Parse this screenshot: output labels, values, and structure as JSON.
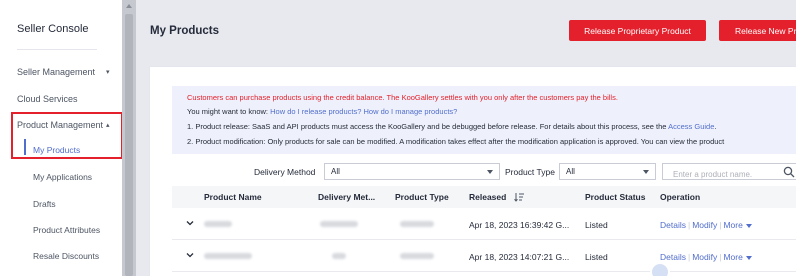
{
  "sidebar": {
    "title": "Seller Console",
    "items": [
      {
        "label": "Seller Management",
        "caret": "▾"
      },
      {
        "label": "Cloud Services"
      },
      {
        "label": "Product Management",
        "caret": "▴"
      }
    ],
    "sub_items": [
      {
        "label": "My Products",
        "active": true
      },
      {
        "label": "My Applications"
      },
      {
        "label": "Drafts"
      },
      {
        "label": "Product Attributes"
      },
      {
        "label": "Resale Discounts"
      }
    ]
  },
  "header": {
    "title": "My Products",
    "btn_proprietary": "Release Proprietary Product",
    "btn_new": "Release New Pr"
  },
  "notice": {
    "line1": "Customers can purchase products using the credit balance. The KooGallery settles with you only after the customers pay the bills.",
    "line2_prefix": "You might want to know: ",
    "line2_link1": "How do I release products?",
    "line2_link2": "How do I manage products?",
    "line3_text": "1. Product release: SaaS and API products must access the KooGallery and be debugged before release. For details about this process, see the ",
    "line3_link": "Access Guide",
    "line3_suffix": ".",
    "line4": "2. Product modification: Only products for sale can be modified. A modification takes effect after the modification application is approved. You can view the product"
  },
  "filters": {
    "delivery_label": "Delivery Method",
    "delivery_value": "All",
    "type_label": "Product Type",
    "type_value": "All",
    "search_placeholder": "Enter a product name."
  },
  "table": {
    "columns": [
      "Product Name",
      "Delivery Met...",
      "Product Type",
      "Released",
      "Product Status",
      "Operation"
    ],
    "rows": [
      {
        "released": "Apr 18, 2023 16:39:42 G...",
        "status": "Listed",
        "op_details": "Details",
        "op_modify": "Modify",
        "op_more": "More"
      },
      {
        "released": "Apr 18, 2023 14:07:21 G...",
        "status": "Listed",
        "op_details": "Details",
        "op_modify": "Modify",
        "op_more": "More"
      }
    ]
  },
  "colors": {
    "accent_red": "#e3202c",
    "link_blue": "#526ecc"
  },
  "icons": [
    "chevron-down-icon",
    "chevron-up-icon",
    "search-icon",
    "sort-icon",
    "expand-chevron-icon"
  ]
}
